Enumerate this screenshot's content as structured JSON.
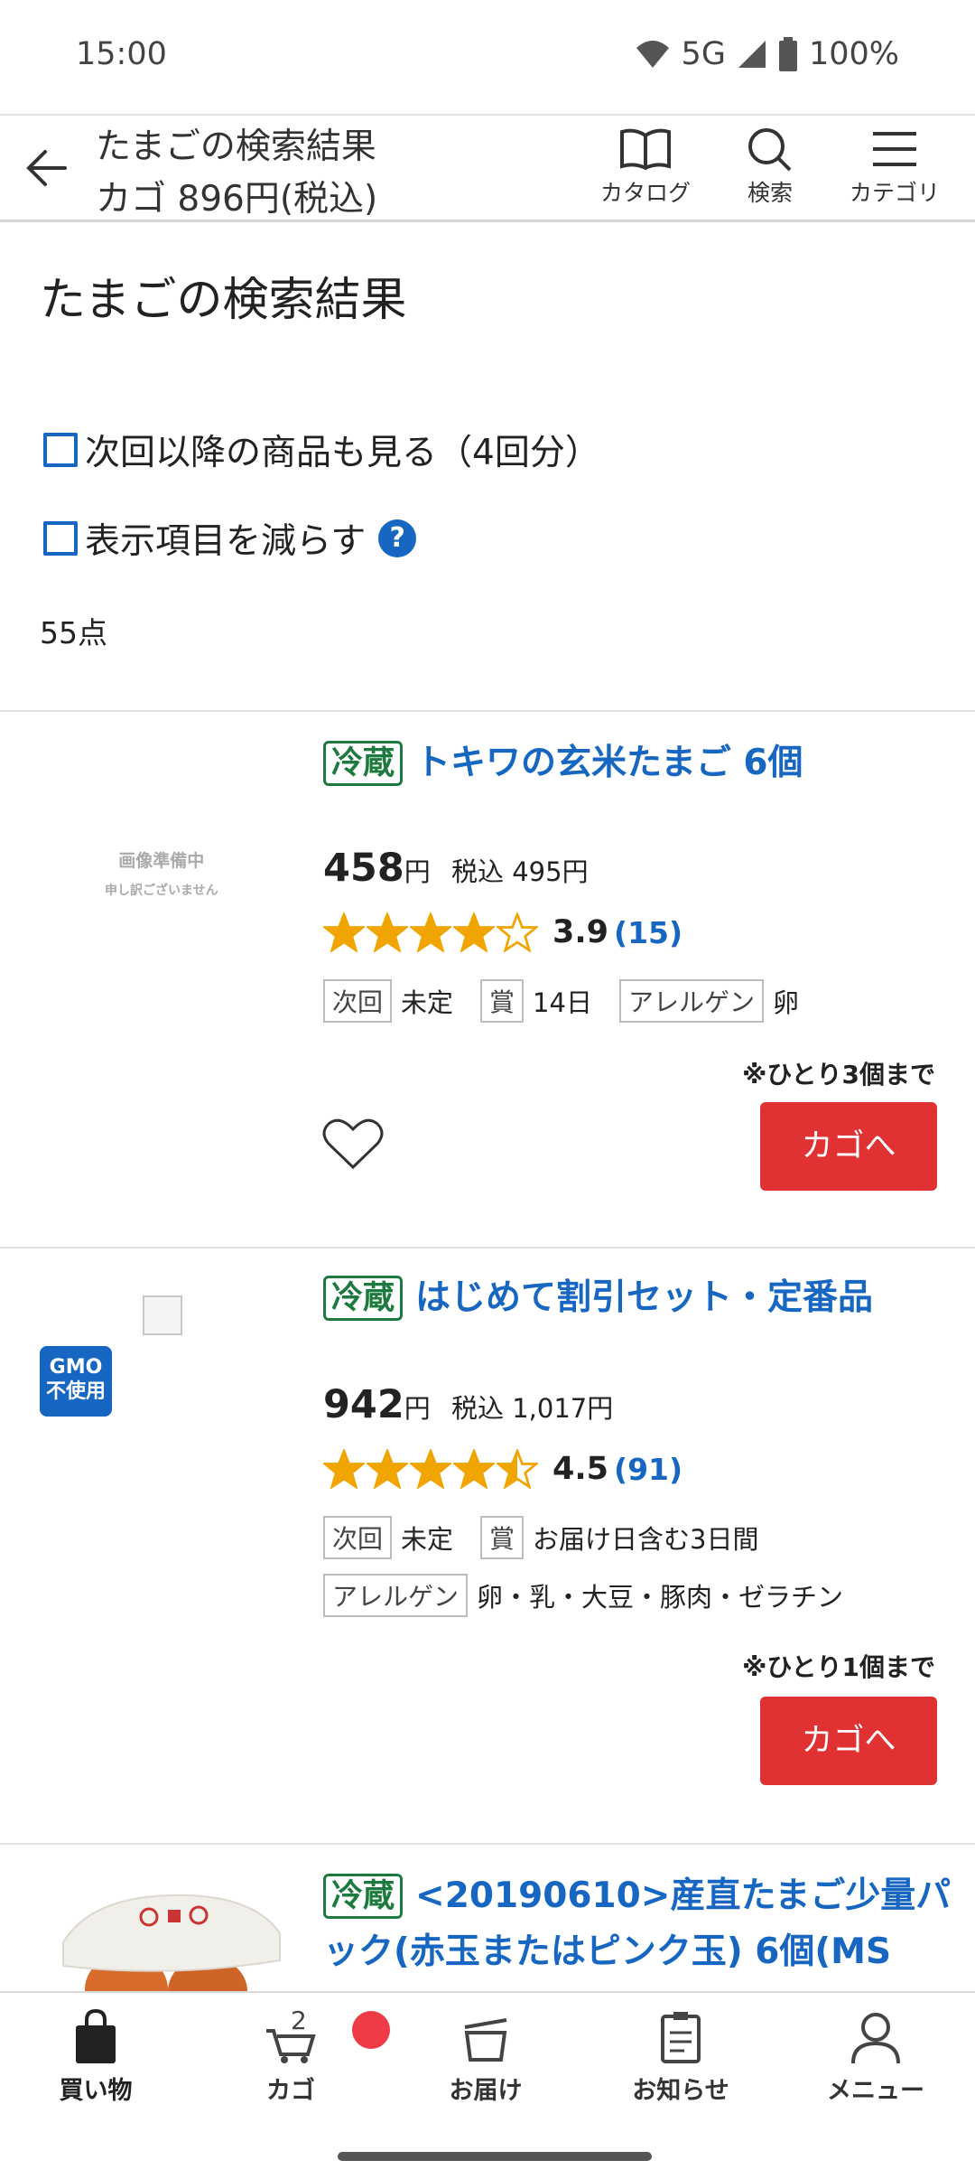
{
  "status_bar": {
    "time": "15:00",
    "network": "5G",
    "battery": "100%"
  },
  "header": {
    "title": "たまごの検索結果",
    "cart_summary": "カゴ 896円(税込)",
    "nav": [
      {
        "label": "カタログ",
        "icon": "book-icon"
      },
      {
        "label": "検索",
        "icon": "search-icon"
      },
      {
        "label": "カテゴリ",
        "icon": "menu-icon"
      }
    ]
  },
  "page": {
    "title": "たまごの検索結果",
    "options": [
      {
        "label": "次回以降の商品も見る（4回分）",
        "checked": false
      },
      {
        "label": "表示項目を減らす",
        "checked": false,
        "help": "?"
      }
    ],
    "count": "55点"
  },
  "products": [
    {
      "tag": "冷蔵",
      "name": "トキワの玄米たまご 6個",
      "image_placeholder": {
        "line1": "画像準備中",
        "line2": "申し訳ございません"
      },
      "price": "458",
      "price_unit": "円",
      "tax_price": "税込 495円",
      "rating": 3.9,
      "rating_text": "3.9",
      "reviews": "(15)",
      "meta_row1": [
        {
          "label": "次回",
          "value": "未定"
        },
        {
          "label": "賞",
          "value": "14日"
        },
        {
          "label": "アレルゲン",
          "value": "卵"
        }
      ],
      "limit": "※ひとり3個まで",
      "cart_button": "カゴへ"
    },
    {
      "tag": "冷蔵",
      "name": "はじめて割引セット・定番品",
      "gmo_badge": {
        "line1": "GMO",
        "line2": "不使用"
      },
      "price": "942",
      "price_unit": "円",
      "tax_price": "税込 1,017円",
      "rating": 4.5,
      "rating_text": "4.5",
      "reviews": "(91)",
      "meta_row1": [
        {
          "label": "次回",
          "value": "未定"
        },
        {
          "label": "賞",
          "value": "お届け日含む3日間"
        }
      ],
      "meta_row2": [
        {
          "label": "アレルゲン",
          "value": "卵・乳・大豆・豚肉・ゼラチン"
        }
      ],
      "limit": "※ひとり1個まで",
      "cart_button": "カゴへ"
    },
    {
      "tag": "冷蔵",
      "name_line1": "<20190610>産直たまご少量パ",
      "name_line2": "ック(赤玉またはピンク玉) 6個(MS"
    }
  ],
  "bottom_nav": {
    "items": [
      {
        "label": "買い物",
        "icon": "shopping-bag-icon",
        "active": true
      },
      {
        "label": "カゴ",
        "icon": "cart-icon",
        "badge": "2"
      },
      {
        "label": "お届け",
        "icon": "box-icon"
      },
      {
        "label": "お知らせ",
        "icon": "clipboard-icon"
      },
      {
        "label": "メニュー",
        "icon": "person-icon"
      }
    ]
  },
  "colors": {
    "accent_blue": "#1767c2",
    "cart_red": "#e03232",
    "chilled_green": "#1c7a3f",
    "star": "#f0a500"
  }
}
